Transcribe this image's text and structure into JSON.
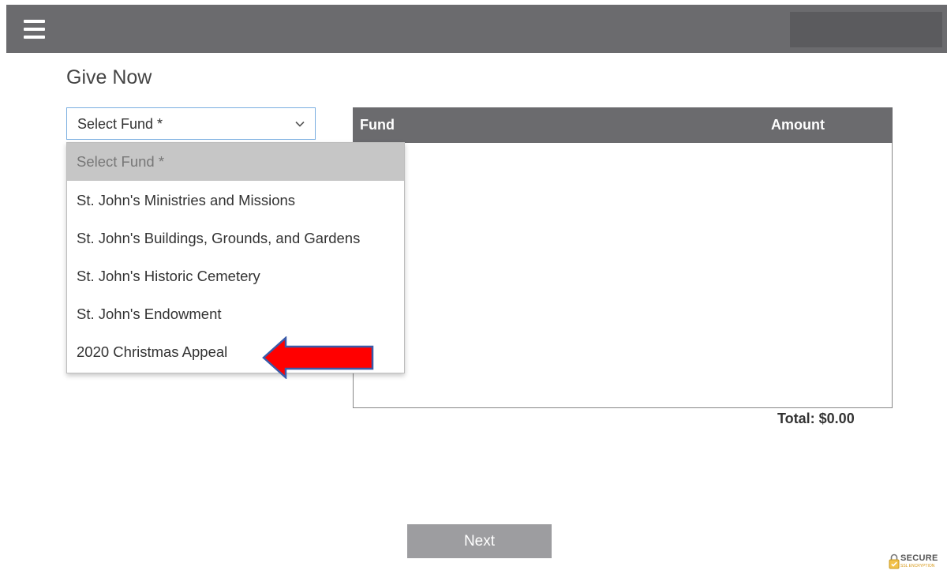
{
  "header": {
    "menu_icon": "hamburger-menu-icon"
  },
  "page": {
    "title": "Give Now"
  },
  "fund_select": {
    "value": "Select Fund *",
    "icon": "chevron-down-icon",
    "options": [
      "Select Fund *",
      "St. John's Ministries and Missions",
      "St. John's Buildings, Grounds, and Gardens",
      "St. John's Historic Cemetery",
      "St. John's Endowment",
      "2020 Christmas Appeal"
    ],
    "selected_index": 0
  },
  "table": {
    "columns": [
      "Fund",
      "Amount"
    ],
    "rows": []
  },
  "total": {
    "label": "Total: $0.00"
  },
  "actions": {
    "next_label": "Next"
  },
  "badge": {
    "label": "SECURE",
    "sub": "SSL ENCRYPTION",
    "icon": "padlock-icon"
  },
  "annotation": {
    "icon": "red-arrow-left-icon",
    "fill": "#ff0000",
    "stroke": "#3a5aa8"
  },
  "colors": {
    "header_bg": "#6b6b6e",
    "select_border": "#7aaee0",
    "selected_option_bg": "#c6c6c6",
    "button_bg": "#9d9da0"
  }
}
